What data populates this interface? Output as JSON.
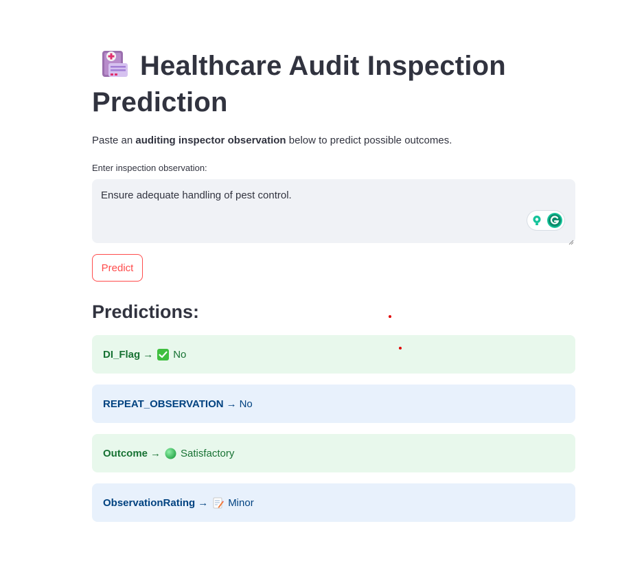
{
  "header": {
    "title": "Healthcare Audit Inspection Prediction",
    "title_icon": "clipboard-medical-icon"
  },
  "intro": {
    "prefix": "Paste an ",
    "bold": "auditing inspector observation",
    "suffix": " below to predict possible outcomes."
  },
  "observation_input": {
    "label": "Enter inspection observation:",
    "value": "Ensure adequate handling of pest control."
  },
  "predict_button": {
    "label": "Predict"
  },
  "predictions": {
    "heading": "Predictions:",
    "items": [
      {
        "key": "DI_Flag",
        "arrow": "→",
        "icon": "check-mark-button-icon",
        "value": "No",
        "style": "green"
      },
      {
        "key": "REPEAT_OBSERVATION",
        "arrow": "→",
        "icon": "",
        "value": "No",
        "style": "blue"
      },
      {
        "key": "Outcome",
        "arrow": "→",
        "icon": "green-circle-icon",
        "value": "Satisfactory",
        "style": "green"
      },
      {
        "key": "ObservationRating",
        "arrow": "→",
        "icon": "memo-icon",
        "value": "Minor",
        "style": "blue"
      }
    ]
  },
  "colors": {
    "accent": "#ff4b4b",
    "success_bg": "#e8f8ec",
    "success_text": "#177233",
    "info_bg": "#e8f1fc",
    "info_text": "#004280",
    "input_bg": "#f0f2f6"
  }
}
